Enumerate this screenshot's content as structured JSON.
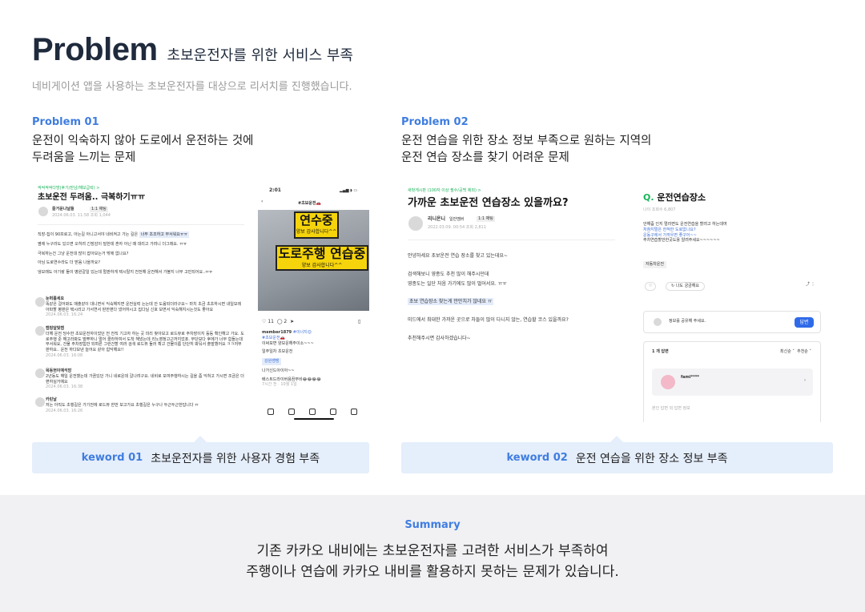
{
  "header": {
    "title": "Problem",
    "title_sub": "초보운전자를 위한 서비스 부족",
    "subtitle": "네비게이션 앱을 사용하는 초보운전자를 대상으로 리서치를 진행했습니다."
  },
  "problems": [
    {
      "label": "Problem 01",
      "desc_line1": "운전이 익숙하지 않아 도로에서 운전하는 것에",
      "desc_line2": "두려움을 느끼는 문제",
      "keyword_num": "keword 01",
      "keyword_text": "초보운전자를 위한 사용자 경험 부족"
    },
    {
      "label": "Problem 02",
      "desc_line1": "운전 연습을 위한 장소 정보 부족으로 원하는 지역의",
      "desc_line2": "운전 연습 장소를 찾기 어려운 문제",
      "keyword_num": "keword 02",
      "keyword_text": "운전 연습을 위한 장소 정보 부족"
    }
  ],
  "shot1": {
    "category": "싹싹싹싹다방(후기/만남/해보급락) >",
    "post_title": "초보운전 두려움.. 극복하기ㅠㅠ",
    "author": "즐거운나날들",
    "level": "1:1 채팅",
    "date": "2024.06.03. 11:58  조회 1,044",
    "body_1": "직장-집이 90프로고, 아는길 아니고서야 네비켜고 가는 길은",
    "body_1_hl": "너무 초조하고 무서워요ㅠㅠ",
    "body_2": "옆에 누구라도 있으면 오히려 긴장감이 덜한데 혼자 아닌 때 대리고 가려니 더그래요. ㅠㅠ",
    "body_3": "극복하는건 그냥 운전대 많이 잡아보는거 밖에 없나요?",
    "body_4": "아님 도로연수라도 더 받음 나을까요?",
    "body_5": "냉모래도 아기랑 둘이 병원갈일 있는데 멀판하게 택시탈지 전전해 운전해서 가볼지 너무 고민되어요..ㅠㅠ",
    "c1_name": "눈떠를세요",
    "c1_text": "똑같은 걸어봐도 매출같이 대니면서 익숙해지면 운전실력 는는데 안 도움되더라구요~ 마치 초금 초초하시면 내일모레 아파할 평판은 택시라고 가서연서 판한편다 냈어하시고 집다닐 신호 보면서 익숙해지시는것도 좋아요",
    "c1_date": "2024.06.03. 16:24",
    "c2_name": "캠핑달빛캠",
    "c2_text": "더해 운전 당수한 초보운전자이었던 전 전직 기고자 하는 곳 미리 찾아보고 로드뷰로 주차장이지 등등 확인해고 가요. 도로주행 준 해고라봐도 떨뿌하니 멀어 콜라하여서 도착 해냈는데 리노영정고근까지었죠. 무단보다 후에가 너무 힘들는대 무서워요, 건물 주차장힘만 되며른 그런건할 여러 검색 로드뷰 둘러 확고 건물이름 단단히 봐둬서 출발했어요 ㅋㅋ저무판하요.. 운전 하다보낸 늘어요 같아 힘닥해요!!",
    "c2_date": "2024.06.03. 16:08",
    "c3_name": "목동현이예석맘",
    "c3_text": "2년동도 해일 운전했는데 가끔있던 가니 네로운데 갈나려구요. 네비로 모여주행하시는 길을 좀 익혀고 가시면 조금은 더 편하실거예요",
    "c3_date": "2024.06.03. 16:38",
    "c4_name": "카린날",
    "c4_text": "저는 아직도 초행길은 가기전에 로드뷰 한번 보고가요 초행길은 누구나 두근두근한답니다 ㅠ",
    "c4_date": "2024.06.03. 16:26",
    "phone_time": "2:01",
    "phone_header": "#초보운전🚗",
    "sign1_big": "연수중",
    "sign1_small": "양보 감사합니다^^",
    "sign2_big": "도로주행 연습중",
    "sign2_small": "양보 감사합니다^^",
    "likes": "11",
    "comments": "2",
    "member": "member1879",
    "member_tag": "#이너지😊",
    "tag_line": "#초보운전🚗",
    "desc_a": "이써보면 양보운해주이소~~~",
    "desc_b": "일주일차 초보운전",
    "chip": "강원쌩쌩",
    "desc_c": "나가신드아이아~~",
    "desc_d": "배스트드라이버용끔무비😂😂😂😂",
    "phone_date": "7시간 전 · 10월 1일"
  },
  "shot2": {
    "category": "새벗게시판 (100자 이상 필수/공백 제외) >",
    "post_title": "가까운 초보운전 연습장소 있을까요?",
    "author": "리니온니",
    "author_level": "일반멤버",
    "chat": "1:1 채팅",
    "date": "2022.03.09. 00:54  조회 2,811",
    "body_1": "안녕하세요 초보운전 연습 장소를 찾고 있는데요~",
    "body_2": "검색해보니 영종도 추천 많이 해주시던데",
    "body_3": "영종도는 일단 처음 가기에도 많이 멀어서요. ㅠㅠ",
    "body_hl": "초보 연습장소 찾는게 만만치가 않네요 ㅠ",
    "body_4": "미드에서 최대한 가까운 곳으로 차들이 많이 다니지 않는, 연습할 코스 있을까요?",
    "body_5": "추천해주시면 감사하겠습니다~",
    "q_title": "운전연습장소",
    "q_meta": "나이  조회수 6,807",
    "q_text_1": "안해줌 인지 멀라면도 운전연습을 할려고 하는데여",
    "q_text_hl1": "처참지멀은 한적한 도로없나요?",
    "q_text_hl2": "운동구에서 가까우면 좋구어~~",
    "q_text_4": "주차연습할만한곳도용 알려주세요~~~~~~",
    "q_tag": "자동차운전",
    "q_like": "나도 궁금해요",
    "answer_hint": "정보를 공유해 주세요.",
    "answer_btn": "답변",
    "answers_count": "1 개 답변",
    "sort_a": "최신순",
    "sort_b": "추천순",
    "answer_user": "fami****",
    "answer_foot": "본인 답변 외 답변 정보"
  },
  "summary": {
    "label": "Summary",
    "line1": "기존 카카오 내비에는 초보운전자를 고려한 서비스가 부족하여",
    "line2": "주행이나 연습에 카카오 내비를 활용하지 못하는 문제가 있습니다."
  }
}
